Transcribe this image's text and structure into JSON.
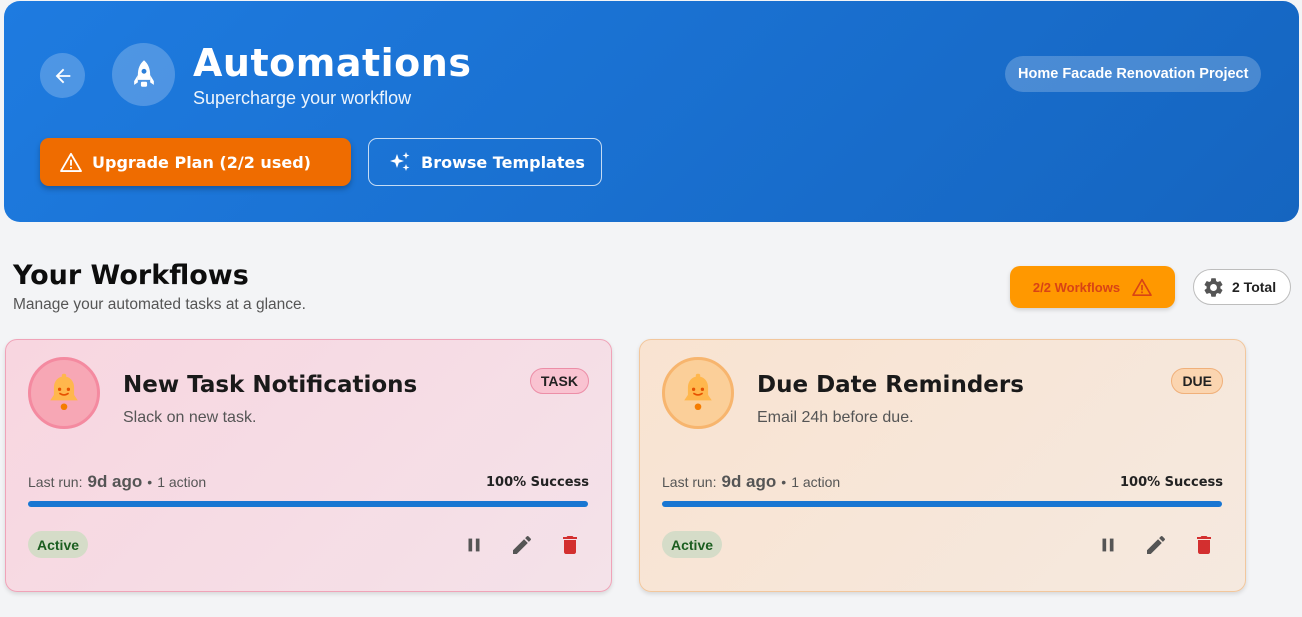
{
  "header": {
    "title": "Automations",
    "subtitle": "Supercharge your workflow",
    "project": "Home Facade Renovation Project",
    "upgrade_label": "Upgrade Plan (2/2 used)",
    "templates_label": "Browse Templates",
    "back_icon": "arrow-left-icon",
    "logo_icon": "rocket-icon"
  },
  "section": {
    "title": "Your Workflows",
    "subtitle": "Manage your automated tasks at a glance.",
    "quota_label": "2/2 Workflows",
    "total_label": "2 Total"
  },
  "workflows": [
    {
      "title": "New Task Notifications",
      "description": "Slack on new task.",
      "tag": "TASK",
      "last_run_label": "Last run:",
      "last_run": "9d ago",
      "actions_count": "1 action",
      "success": "100% Success",
      "success_fraction": 1.0,
      "status": "Active",
      "icon": "bell-icon",
      "theme": "pink"
    },
    {
      "title": "Due Date Reminders",
      "description": "Email 24h before due.",
      "tag": "DUE",
      "last_run_label": "Last run:",
      "last_run": "9d ago",
      "actions_count": "1 action",
      "success": "100% Success",
      "success_fraction": 1.0,
      "status": "Active",
      "icon": "bell-icon",
      "theme": "peach"
    }
  ],
  "colors": {
    "hero_blue": "#1565c0",
    "upgrade_orange": "#ef6c00",
    "quota_orange": "#ff9800",
    "progress_blue": "#1976d2",
    "delete_red": "#d32f2f",
    "active_green": "#1b5e20"
  }
}
